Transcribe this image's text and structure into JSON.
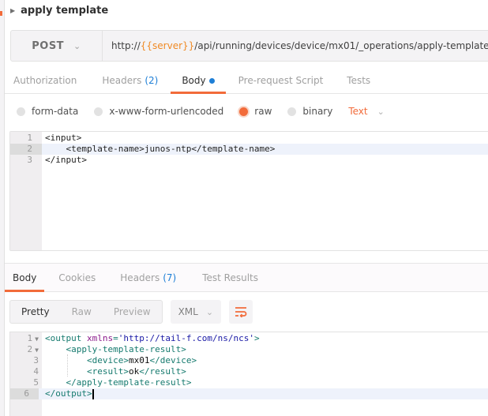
{
  "request": {
    "name": "apply template",
    "method": "POST",
    "url_prefix": "http://",
    "url_variable": "{{server}}",
    "url_suffix": "/api/running/devices/device/mx01/_operations/apply-template..."
  },
  "request_tabs": [
    {
      "label": "Authorization",
      "count": null,
      "active": false
    },
    {
      "label": "Headers",
      "count": "(2)",
      "active": false
    },
    {
      "label": "Body",
      "count": null,
      "active": true,
      "modified_dot": true
    },
    {
      "label": "Pre-request Script",
      "count": null,
      "active": false
    },
    {
      "label": "Tests",
      "count": null,
      "active": false
    }
  ],
  "body_types": [
    {
      "label": "form-data",
      "selected": false
    },
    {
      "label": "x-www-form-urlencoded",
      "selected": false
    },
    {
      "label": "raw",
      "selected": true
    },
    {
      "label": "binary",
      "selected": false
    }
  ],
  "raw_format": "Text",
  "request_body_lines": [
    {
      "n": "1",
      "text": "<input>"
    },
    {
      "n": "2",
      "text": "    <template-name>junos-ntp</template-name>"
    },
    {
      "n": "3",
      "text": "</input>"
    }
  ],
  "response_tabs": [
    {
      "label": "Body",
      "count": null,
      "active": true
    },
    {
      "label": "Cookies",
      "count": null,
      "active": false
    },
    {
      "label": "Headers",
      "count": "(7)",
      "active": false
    },
    {
      "label": "Test Results",
      "count": null,
      "active": false
    }
  ],
  "response_view": {
    "modes": [
      "Pretty",
      "Raw",
      "Preview"
    ],
    "active_mode": "Pretty",
    "language": "XML",
    "wrap_icon": "wrap-lines-icon"
  },
  "response_body_lines": [
    {
      "n": "1",
      "fold": true
    },
    {
      "n": "2",
      "fold": true
    },
    {
      "n": "3",
      "fold": false
    },
    {
      "n": "4",
      "fold": false
    },
    {
      "n": "5",
      "fold": false
    },
    {
      "n": "6",
      "fold": false
    }
  ],
  "response_xml": {
    "output_tag": "output",
    "xmlns_attr": "xmlns",
    "xmlns_value": "'http://tail-f.com/ns/ncs'",
    "result_wrapper": "apply-template-result",
    "device_tag": "device",
    "device_value": "mx01",
    "result_tag": "result",
    "result_value": "ok"
  },
  "colors": {
    "accent": "#f26b3a",
    "variable": "#f08a24",
    "count": "#1e7fd6"
  }
}
